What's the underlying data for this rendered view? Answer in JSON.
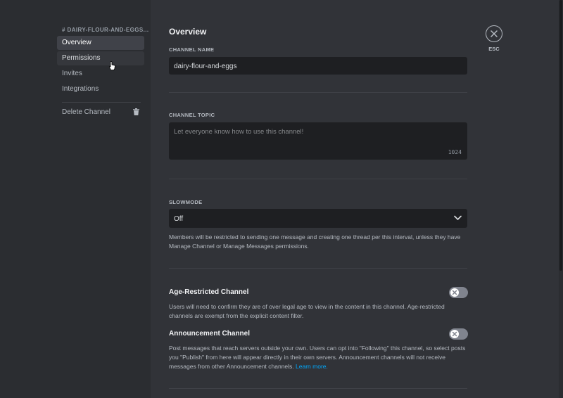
{
  "sidebar": {
    "channel_header": "# DAIRY-FLOUR-AND-EGGS...",
    "items": [
      {
        "label": "Overview",
        "state": "selected"
      },
      {
        "label": "Permissions",
        "state": "hover"
      },
      {
        "label": "Invites",
        "state": "normal"
      },
      {
        "label": "Integrations",
        "state": "normal"
      }
    ],
    "delete_label": "Delete Channel"
  },
  "overview": {
    "title": "Overview",
    "channel_name": {
      "label": "CHANNEL NAME",
      "value": "dairy-flour-and-eggs"
    },
    "channel_topic": {
      "label": "CHANNEL TOPIC",
      "placeholder": "Let everyone know how to use this channel!",
      "counter": "1024"
    },
    "slowmode": {
      "label": "SLOWMODE",
      "selected": "Off",
      "description": "Members will be restricted to sending one message and creating one thread per this interval, unless they have Manage Channel or Manage Messages permissions."
    },
    "age_restricted": {
      "title": "Age-Restricted Channel",
      "enabled": false,
      "description": "Users will need to confirm they are of over legal age to view in the content in this channel. Age-restricted channels are exempt from the explicit content filter."
    },
    "announcement": {
      "title": "Announcement Channel",
      "enabled": false,
      "description": "Post messages that reach servers outside your own. Users can opt into \"Following\" this channel, so select posts you \"Publish\" from here will appear directly in their own servers. Announcement channels will not receive messages from other Announcement channels.",
      "link": "Learn more."
    }
  },
  "close": {
    "label": "ESC"
  },
  "colors": {
    "accent_link": "#00a8fc",
    "selected_nav": "#404249",
    "toggle_off": "#80848e"
  },
  "icons": [
    "close-icon",
    "trash-icon",
    "chevron-down-icon",
    "x-icon",
    "pointer-cursor-icon"
  ]
}
